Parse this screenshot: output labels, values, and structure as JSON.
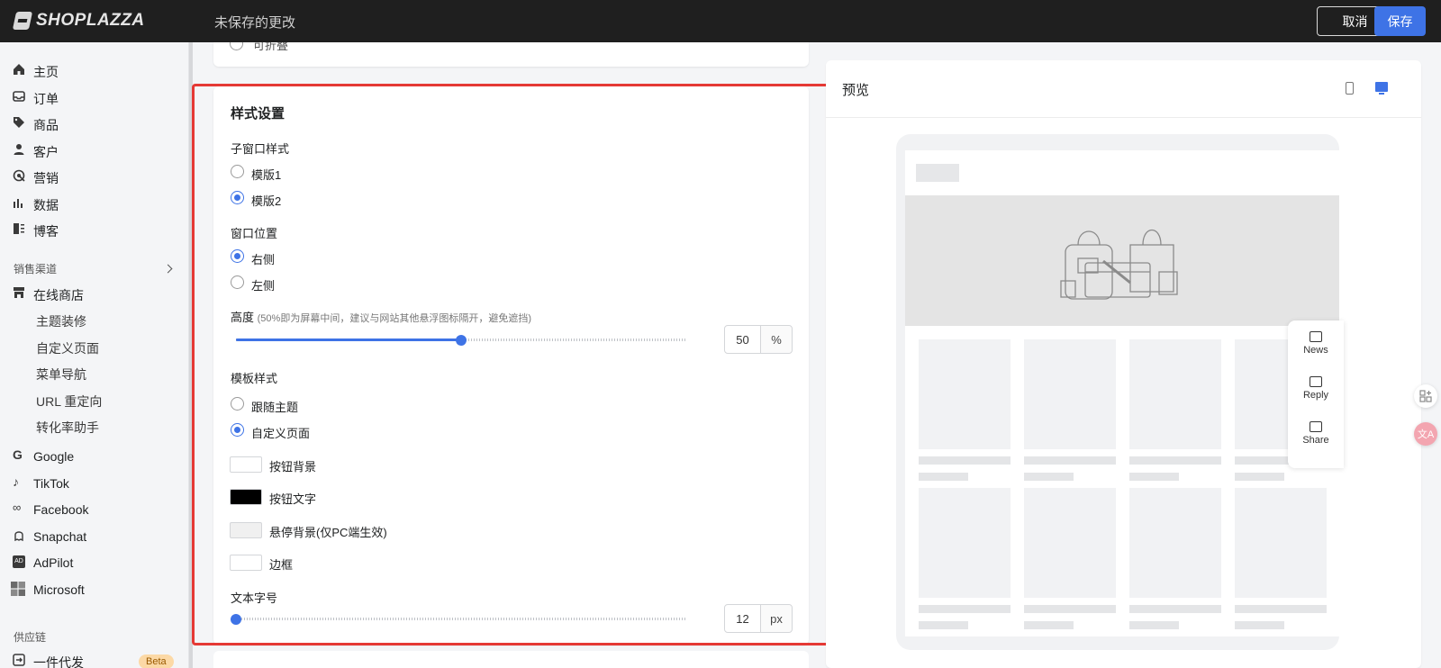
{
  "topbar": {
    "logo": "SHOPLAZZA",
    "unsaved": "未保存的更改",
    "cancel": "取消",
    "save": "保存"
  },
  "sidebar": {
    "items": [
      {
        "label": "主页",
        "icon": "home-icon"
      },
      {
        "label": "订单",
        "icon": "inbox-icon"
      },
      {
        "label": "商品",
        "icon": "tag-icon"
      },
      {
        "label": "客户",
        "icon": "person-icon"
      },
      {
        "label": "营销",
        "icon": "target-icon"
      },
      {
        "label": "数据",
        "icon": "bar-chart-icon"
      },
      {
        "label": "博客",
        "icon": "blog-icon"
      }
    ],
    "sales_channels_heading": "销售渠道",
    "online_store": "在线商店",
    "online_store_sub": [
      "主题装修",
      "自定义页面",
      "菜单导航",
      "URL 重定向",
      "转化率助手"
    ],
    "channels": [
      {
        "label": "Google",
        "icon": "google-icon"
      },
      {
        "label": "TikTok",
        "icon": "tiktok-icon"
      },
      {
        "label": "Facebook",
        "icon": "meta-icon"
      },
      {
        "label": "Snapchat",
        "icon": "ghost-icon"
      },
      {
        "label": "AdPilot",
        "icon": "adpilot-icon"
      },
      {
        "label": "Microsoft",
        "icon": "microsoft-icon"
      }
    ],
    "supply_heading": "供应链",
    "dropship": "一件代发",
    "beta": "Beta"
  },
  "top_card": {
    "cut_option": "可折叠"
  },
  "style_settings": {
    "title": "样式设置",
    "subwindow_style_label": "子窗口样式",
    "subwindow_options": [
      "模版1",
      "模版2"
    ],
    "subwindow_selected": "模版2",
    "position_label": "窗口位置",
    "position_options": [
      "右侧",
      "左侧"
    ],
    "position_selected": "右侧",
    "height_label": "高度",
    "height_hint": "(50%即为屏幕中间，建议与网站其他悬浮图标隔开，避免遮挡)",
    "height_value": "50",
    "height_unit": "%",
    "height_fraction": 0.5,
    "template_label": "模板样式",
    "template_options": [
      "跟随主题",
      "自定义页面"
    ],
    "template_selected": "自定义页面",
    "colors": [
      {
        "label": "按钮背景",
        "color": "#ffffff"
      },
      {
        "label": "按钮文字",
        "color": "#000000"
      },
      {
        "label": "悬停背景(仅PC端生效)",
        "color": "#f0f0f0"
      },
      {
        "label": "边框",
        "color": "#ffffff"
      }
    ],
    "font_size_label": "文本字号",
    "font_size_value": "12",
    "font_size_unit": "px",
    "font_size_fraction": 0.0
  },
  "preview": {
    "title": "预览",
    "widget_items": [
      {
        "label": "News",
        "icon": "message-icon"
      },
      {
        "label": "Reply",
        "icon": "edit-icon"
      },
      {
        "label": "Share",
        "icon": "share-icon"
      }
    ]
  },
  "colors": {
    "accent": "#3e73e6",
    "topbar": "#1f1f1f",
    "highlight": "#e53935"
  }
}
